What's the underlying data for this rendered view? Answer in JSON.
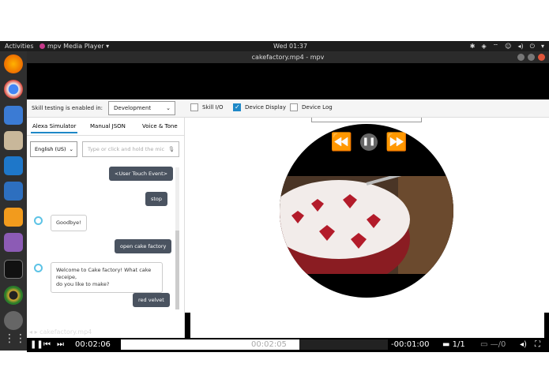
{
  "topbar": {
    "activities": "Activities",
    "app_name": "mpv Media Player",
    "clock": "Wed 01:37"
  },
  "window": {
    "title": "cakefactory.mp4 - mpv"
  },
  "sim": {
    "skill_testing_label": "Skill testing is enabled in:",
    "stage_value": "Development",
    "checkboxes": [
      {
        "label": "Skill I/O",
        "checked": false
      },
      {
        "label": "Device Display",
        "checked": true
      },
      {
        "label": "Device Log",
        "checked": false
      }
    ],
    "tabs": [
      "Alexa Simulator",
      "Manual JSON",
      "Voice & Tone"
    ],
    "language": "English (US)",
    "utterance_placeholder": "Type or click and hold the mic",
    "messages": {
      "m1": "<User Touch Event>",
      "m2": "stop",
      "m3": "Goodbye!",
      "m4": "open cake factory",
      "m5": "Welcome to Cake factory! What cake receipe,",
      "m5b": "do you like to make?",
      "m6": "red velvet"
    }
  },
  "player": {
    "filename": "cakefactory.mp4",
    "elapsed": "00:02:06",
    "hover_time": "00:02:05",
    "remaining": "-00:01:00",
    "subtitle": "1/1",
    "audio": "—/0",
    "progress_fraction": 0.67
  }
}
